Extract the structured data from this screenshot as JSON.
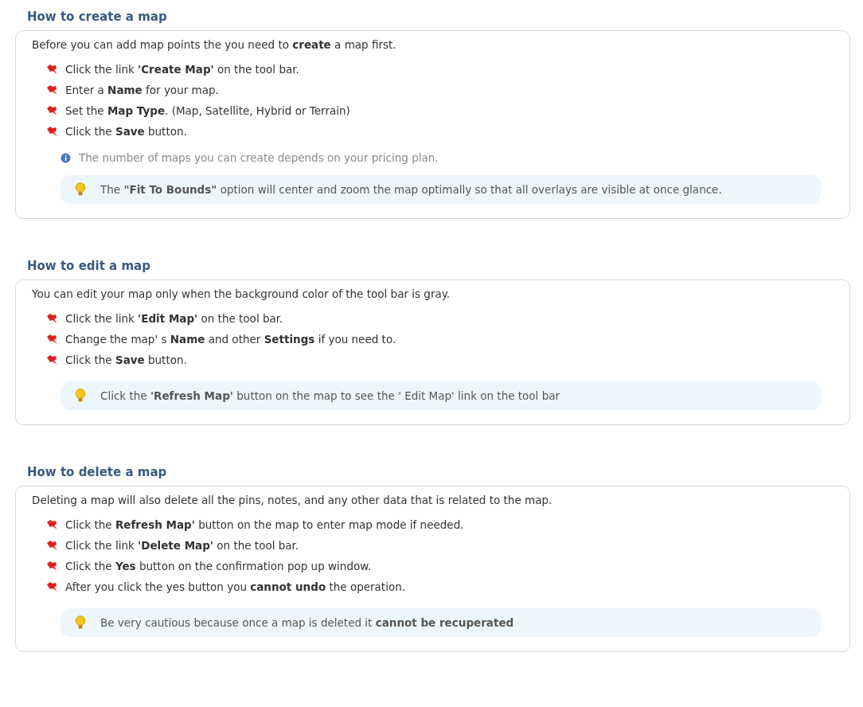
{
  "sections": [
    {
      "title": "How to create a map",
      "intro": "Before you can add map points the you need to **create** a map first.",
      "steps": [
        "Click the link **'Create Map'** on the tool bar.",
        "Enter a **Name** for your map.",
        "Set the **Map Type**. (Map, Satellite, Hybrid or Terrain)",
        "Click the **Save** button."
      ],
      "info": "The number of maps you can create depends on your pricing plan.",
      "tip": "The **\"Fit To Bounds\"** option will center and zoom the map optimally so that all overlays are visible at once glance."
    },
    {
      "title": "How to edit a map",
      "intro": "You can edit your map only when the background color of the tool bar is gray.",
      "steps": [
        "Click the link **'Edit Map'** on the tool bar.",
        "Change the map' s **Name** and other **Settings** if you need to.",
        "Click the **Save** button."
      ],
      "tip": "Click the **'Refresh Map'** button on the map to see the ' Edit Map'  link on the tool bar"
    },
    {
      "title": "How to delete a map",
      "intro": "Deleting a map will also delete all the pins, notes, and any other data that is related to the map.",
      "steps": [
        "Click the **Refresh Map'** button on the map to enter map mode if needed.",
        "Click the link **'Delete Map'** on the tool bar.",
        "Click the **Yes** button on the confirmation pop up window.",
        "After you click the yes button you **cannot undo** the operation."
      ],
      "tip": "Be very cautious because once a map is deleted it **cannot be recuperated**"
    }
  ]
}
